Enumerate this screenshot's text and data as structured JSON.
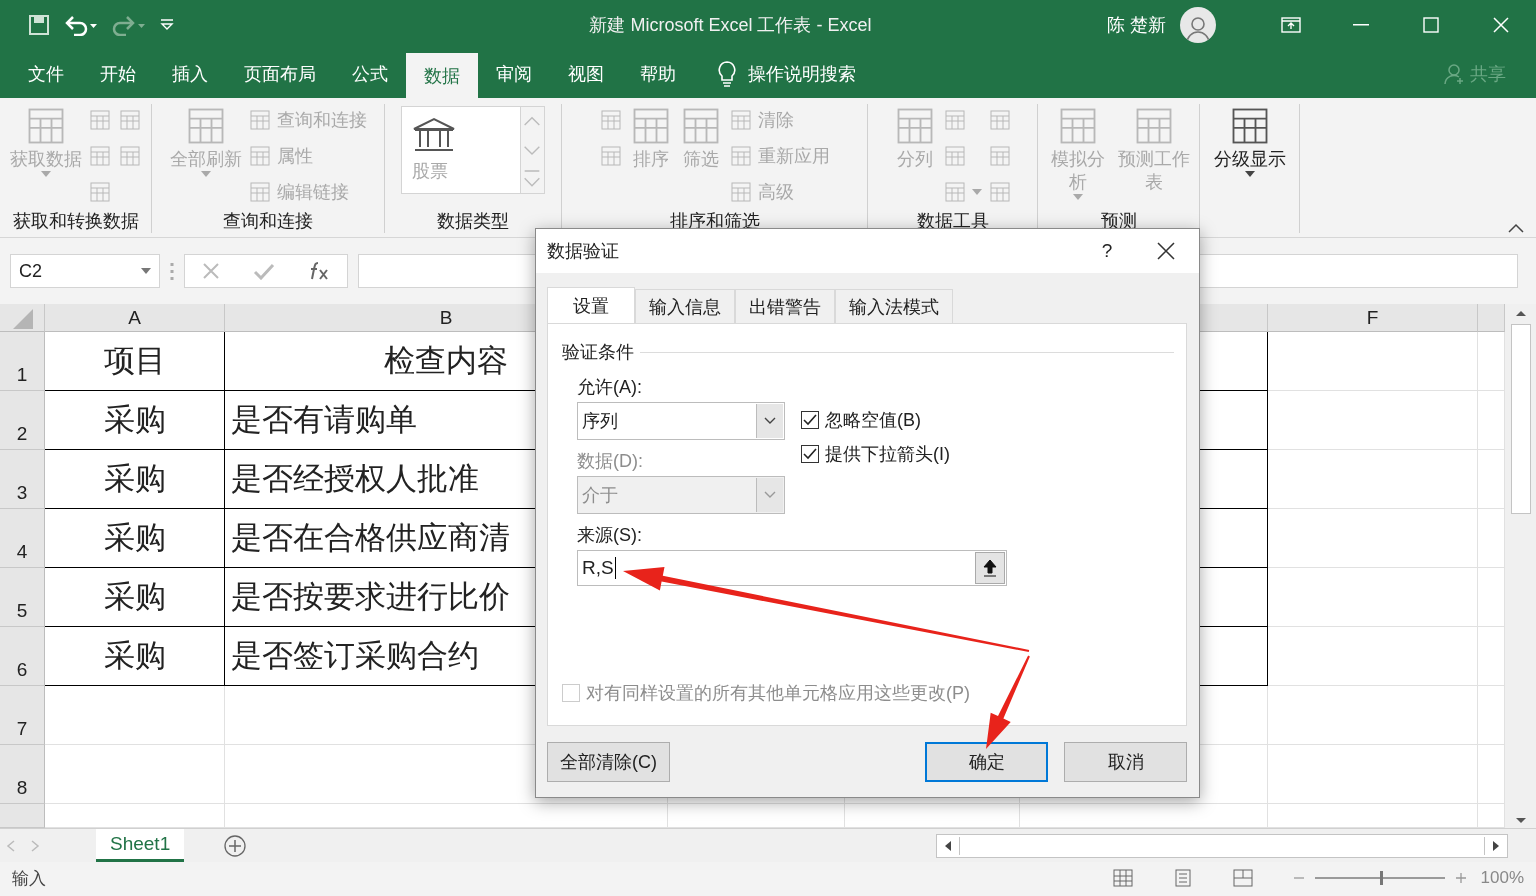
{
  "window": {
    "title": "新建 Microsoft Excel 工作表  -  Excel",
    "user": "陈 楚新"
  },
  "menu_tabs": [
    {
      "label": "文件",
      "selected": false
    },
    {
      "label": "开始",
      "selected": false
    },
    {
      "label": "插入",
      "selected": false
    },
    {
      "label": "页面布局",
      "selected": false
    },
    {
      "label": "公式",
      "selected": false
    },
    {
      "label": "数据",
      "selected": true
    },
    {
      "label": "审阅",
      "selected": false
    },
    {
      "label": "视图",
      "selected": false
    },
    {
      "label": "帮助",
      "selected": false
    }
  ],
  "tell_me": "操作说明搜索",
  "share": "共享",
  "ribbon_groups": [
    {
      "title": "获取和转换数据",
      "columns": [
        [
          {
            "kind": "large",
            "label": "获取数据",
            "disabled": true,
            "dropdown": true
          }
        ],
        [
          {
            "kind": "icon",
            "disabled": true
          },
          {
            "kind": "icon",
            "disabled": true
          },
          {
            "kind": "icon",
            "disabled": true
          }
        ],
        [
          {
            "kind": "icon",
            "disabled": true
          },
          {
            "kind": "icon",
            "disabled": true
          }
        ]
      ]
    },
    {
      "title": "查询和连接",
      "columns": [
        [
          {
            "kind": "large",
            "label": "全部刷新",
            "disabled": true,
            "dropdown": true
          }
        ],
        [
          {
            "kind": "small",
            "label": "查询和连接",
            "disabled": true
          },
          {
            "kind": "small",
            "label": "属性",
            "disabled": true
          },
          {
            "kind": "small",
            "label": "编辑链接",
            "disabled": true
          }
        ]
      ]
    },
    {
      "title": "数据类型",
      "columns": [
        [
          {
            "kind": "gallery",
            "label": "股票",
            "disabled": true
          }
        ]
      ]
    },
    {
      "title": "排序和筛选",
      "columns": [
        [
          {
            "kind": "icon",
            "disabled": true
          },
          {
            "kind": "icon",
            "disabled": true
          }
        ],
        [
          {
            "kind": "large",
            "label": "排序",
            "disabled": true
          }
        ],
        [
          {
            "kind": "large",
            "label": "筛选",
            "disabled": true
          }
        ],
        [
          {
            "kind": "small",
            "label": "清除",
            "disabled": true
          },
          {
            "kind": "small",
            "label": "重新应用",
            "disabled": true
          },
          {
            "kind": "small",
            "label": "高级",
            "disabled": true
          }
        ]
      ]
    },
    {
      "title": "数据工具",
      "columns": [
        [
          {
            "kind": "large",
            "label": "分列",
            "disabled": true
          }
        ],
        [
          {
            "kind": "icon",
            "disabled": true
          },
          {
            "kind": "icon",
            "disabled": true
          },
          {
            "kind": "icon",
            "disabled": true,
            "dropdown": true
          }
        ],
        [
          {
            "kind": "icon",
            "disabled": true
          },
          {
            "kind": "icon",
            "disabled": true
          },
          {
            "kind": "icon",
            "disabled": true
          }
        ]
      ]
    },
    {
      "title": "预测",
      "columns": [
        [
          {
            "kind": "large",
            "label": "模拟分析",
            "disabled": true,
            "dropdown": true
          }
        ],
        [
          {
            "kind": "large",
            "label": "预测工作表",
            "disabled": true
          }
        ]
      ]
    },
    {
      "columns": [
        [
          {
            "kind": "large",
            "label": "分级显示",
            "disabled": false,
            "dropdown": true
          }
        ]
      ]
    }
  ],
  "name_box": "C2",
  "columns": [
    "A",
    "B",
    "F"
  ],
  "rows": [
    {
      "number": "1",
      "cells": [
        "项目",
        "检查内容"
      ]
    },
    {
      "number": "2",
      "cells": [
        "采购",
        "是否有请购单"
      ]
    },
    {
      "number": "3",
      "cells": [
        "采购",
        "是否经授权人批准"
      ]
    },
    {
      "number": "4",
      "cells": [
        "采购",
        "是否在合格供应商清"
      ]
    },
    {
      "number": "5",
      "cells": [
        "采购",
        "是否按要求进行比价"
      ]
    },
    {
      "number": "6",
      "cells": [
        "采购",
        "是否签订采购合约"
      ]
    },
    {
      "number": "7"
    },
    {
      "number": "8"
    }
  ],
  "sheet_tabs": [
    {
      "label": "Sheet1",
      "selected": true
    }
  ],
  "status_bar": {
    "mode": "输入",
    "zoom": "100%",
    "zoom_slider": {
      "level": 0.5
    }
  },
  "dialog": {
    "title": "数据验证",
    "help": "?",
    "tabs": [
      {
        "label": "设置",
        "selected": true
      },
      {
        "label": "输入信息",
        "selected": false
      },
      {
        "label": "出错警告",
        "selected": false
      },
      {
        "label": "输入法模式",
        "selected": false
      }
    ],
    "section": "验证条件",
    "allow": {
      "label": "允许(A):",
      "value": "序列",
      "disabled": false
    },
    "data": {
      "label": "数据(D):",
      "value": "介于",
      "disabled": true
    },
    "options": [
      {
        "label": "忽略空值(B)",
        "checked": true,
        "disabled": false
      },
      {
        "label": "提供下拉箭头(I)",
        "checked": true,
        "disabled": false
      }
    ],
    "source": {
      "label": "来源(S):",
      "value": "R,S"
    },
    "apply_all": {
      "label": "对有同样设置的所有其他单元格应用这些更改(P)",
      "checked": false,
      "disabled": true
    },
    "buttons": [
      {
        "label": "全部清除(C)",
        "default": false
      },
      {
        "label": "确定",
        "default": true
      },
      {
        "label": "取消",
        "default": false
      }
    ]
  }
}
